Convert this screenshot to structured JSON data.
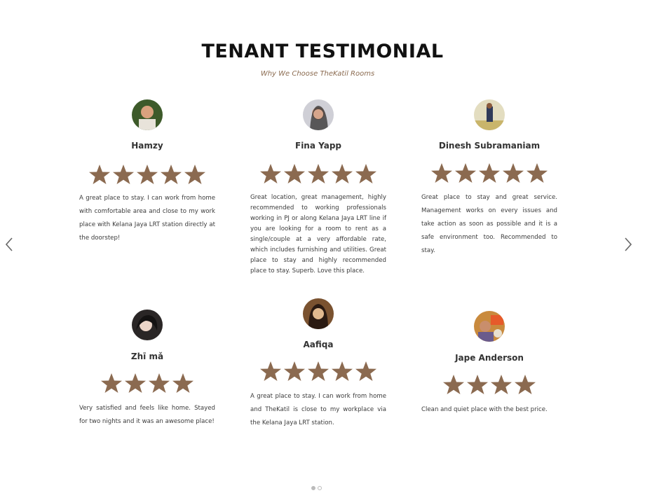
{
  "header": {
    "title": "TENANT TESTIMONIAL",
    "subtitle": "Why We Choose TheKatil Rooms"
  },
  "colors": {
    "star": "#8b6a50",
    "subtitle": "#8a6a4f"
  },
  "testimonials": [
    {
      "name": "Hamzy",
      "rating": 5,
      "text": "A great place to stay. I can work from home with comfortable area and close to my work place with Kelana Jaya LRT station directly at the doorstep!"
    },
    {
      "name": "Fina Yapp",
      "rating": 5,
      "text": "Great location, great management, highly recommended to working professionals working in PJ or along Kelana Jaya LRT line if you are looking for a room to rent as a single/couple at a very affordable rate, which includes furnishing and utilities. Great place to stay and highly recommended place to stay. Superb. Love this place."
    },
    {
      "name": "Dinesh Subramaniam",
      "rating": 5,
      "text": "Great place to stay and great service. Management works on every issues and take action as soon as possible and it is a safe environment too. Recommended to stay."
    },
    {
      "name": "Zhī mǎ",
      "rating": 4,
      "text": "Very satisfied and feels like home. Stayed for two nights and it was an awesome place!"
    },
    {
      "name": "Aafiqa",
      "rating": 5,
      "text": "A great place to stay. I can work from home and TheKatil is close to my workplace via the Kelana Jaya LRT station."
    },
    {
      "name": "Jape Anderson",
      "rating": 4,
      "text": "Clean and quiet place with the best price."
    }
  ],
  "carousel": {
    "page_count": 2,
    "active_page": 1
  }
}
